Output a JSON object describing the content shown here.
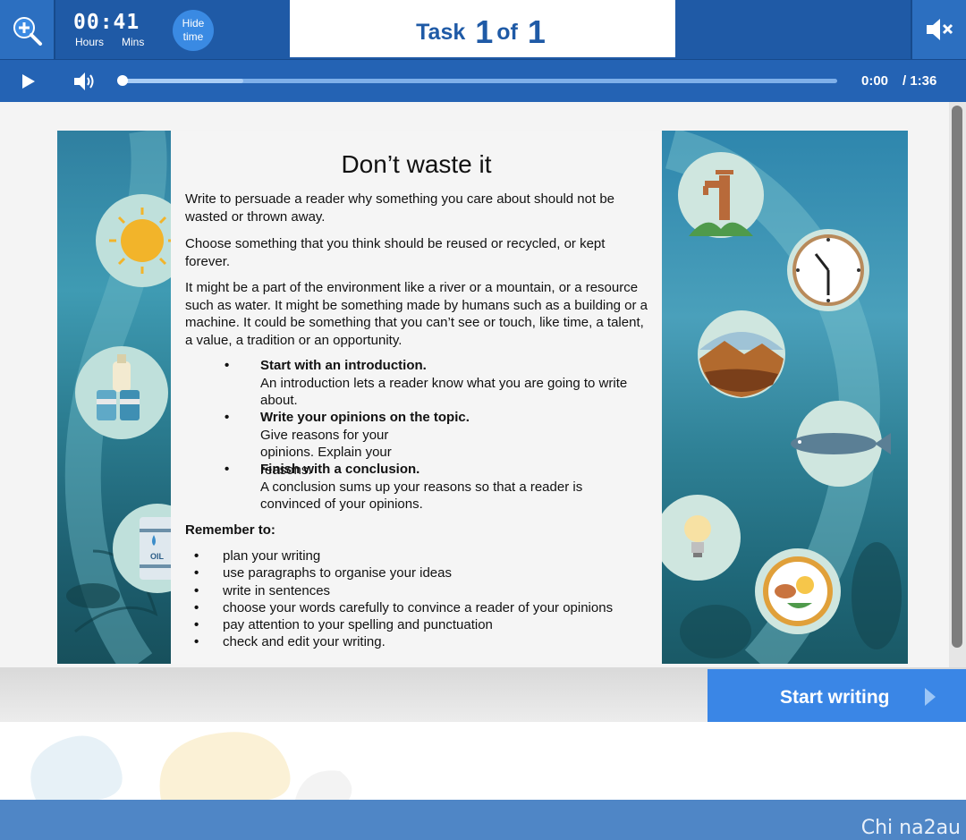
{
  "header": {
    "timer": {
      "digits": "00:41",
      "hours_label": "Hours",
      "mins_label": "Mins"
    },
    "hide_time_label": "Hide time",
    "task": {
      "word": "Task",
      "current": "1",
      "of": "of",
      "total": "1"
    },
    "icons": {
      "zoom": "zoom-in-icon",
      "mute": "speaker-muted-icon"
    }
  },
  "media": {
    "current_time": "0:00",
    "total_time": "/ 1:36",
    "progress": 0,
    "icons": {
      "play": "play-icon",
      "volume": "speaker-icon"
    }
  },
  "document": {
    "title": "Don’t waste it",
    "paragraphs": [
      "Write to persuade a reader why something you care about should not be wasted or thrown away.",
      "Choose something that you think should be reused or recycled, or kept forever.",
      "It might be a part of the environment like a river or a mountain, or a resource such as water. It might be something made by humans such as a building or a machine. It could be something that you can’t see or touch, like time, a talent, a value, a tradition or an opportunity."
    ],
    "steps": [
      {
        "heading": "Start with an introduction.",
        "body": "An introduction lets a reader know what you are going to write about."
      },
      {
        "heading": "Write your opinions on the topic.",
        "body": "Give reasons for your opinions. Explain your reasons."
      },
      {
        "heading": "Finish with a conclusion.",
        "body": "A conclusion sums up your reasons so that a reader is convinced of your opinions."
      }
    ],
    "remember_heading": "Remember to:",
    "remember_items": [
      "plan your writing",
      "use paragraphs to organise your ideas",
      "write in sentences",
      "choose your words carefully to convince a reader of your opinions",
      "pay attention to your spelling and punctuation",
      "check and edit your writing."
    ]
  },
  "illustrations": {
    "left": [
      "sun-icon",
      "bottle-and-cans-icon",
      "oil-barrel-icon"
    ],
    "left_oil_label": "OIL",
    "right": [
      "water-tap-icon",
      "clock-icon",
      "mountain-landscape-icon",
      "fish-icon",
      "light-bulb-icon",
      "food-plate-icon"
    ]
  },
  "actions": {
    "start_writing_label": "Start writing"
  },
  "watermark": "Chi na2au",
  "colors": {
    "primary": "#1f5aa6",
    "media_bar": "#2463b4",
    "button": "#3a86e6",
    "footer": "#4f86c6"
  }
}
